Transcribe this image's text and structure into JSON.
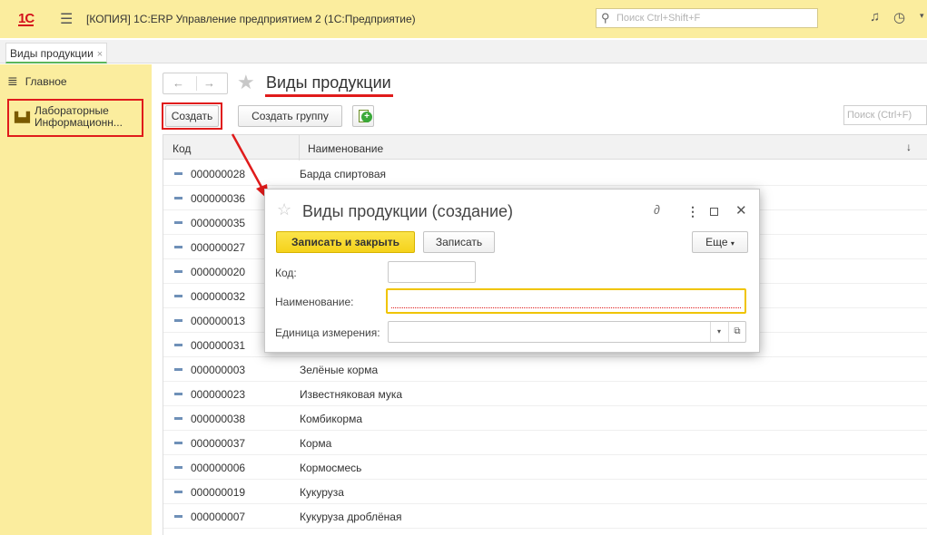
{
  "titlebar": {
    "logo": "1С",
    "app_title": "[КОПИЯ] 1С:ERP Управление предприятием 2  (1С:Предприятие)",
    "search_placeholder": "Поиск Ctrl+Shift+F"
  },
  "tabs": [
    {
      "label": "Виды продукции",
      "close": "×"
    }
  ],
  "sidebar": {
    "items": [
      {
        "label": "Главное"
      },
      {
        "label_line1": "Лабораторные",
        "label_line2": "Информационн..."
      }
    ]
  },
  "content": {
    "title": "Виды продукции",
    "create_label": "Создать",
    "create_group_label": "Создать группу",
    "search_placeholder": "Поиск (Ctrl+F)"
  },
  "table": {
    "headers": {
      "code": "Код",
      "name": "Наименование",
      "sort": "↓"
    },
    "rows": [
      {
        "code": "000000028",
        "name": "Барда спиртовая"
      },
      {
        "code": "000000036",
        "name": ""
      },
      {
        "code": "000000035",
        "name": ""
      },
      {
        "code": "000000027",
        "name": ""
      },
      {
        "code": "000000020",
        "name": ""
      },
      {
        "code": "000000032",
        "name": ""
      },
      {
        "code": "000000013",
        "name": ""
      },
      {
        "code": "000000031",
        "name": ""
      },
      {
        "code": "000000003",
        "name": "Зелёные корма"
      },
      {
        "code": "000000023",
        "name": "Известняковая мука"
      },
      {
        "code": "000000038",
        "name": "Комбикорма"
      },
      {
        "code": "000000037",
        "name": "Корма"
      },
      {
        "code": "000000006",
        "name": "Кормосмесь"
      },
      {
        "code": "000000019",
        "name": "Кукуруза"
      },
      {
        "code": "000000007",
        "name": "Кукуруза дроблёная"
      }
    ]
  },
  "dialog": {
    "title": "Виды продукции (создание)",
    "save_close_label": "Записать и закрыть",
    "save_label": "Записать",
    "more_label": "Еще",
    "fields": {
      "code_label": "Код:",
      "name_label": "Наименование:",
      "unit_label": "Единица измерения:"
    }
  },
  "colors": {
    "accent_yellow": "#fbed9e",
    "primary_button": "#f5d21b",
    "annotation_red": "#e01b1b"
  }
}
